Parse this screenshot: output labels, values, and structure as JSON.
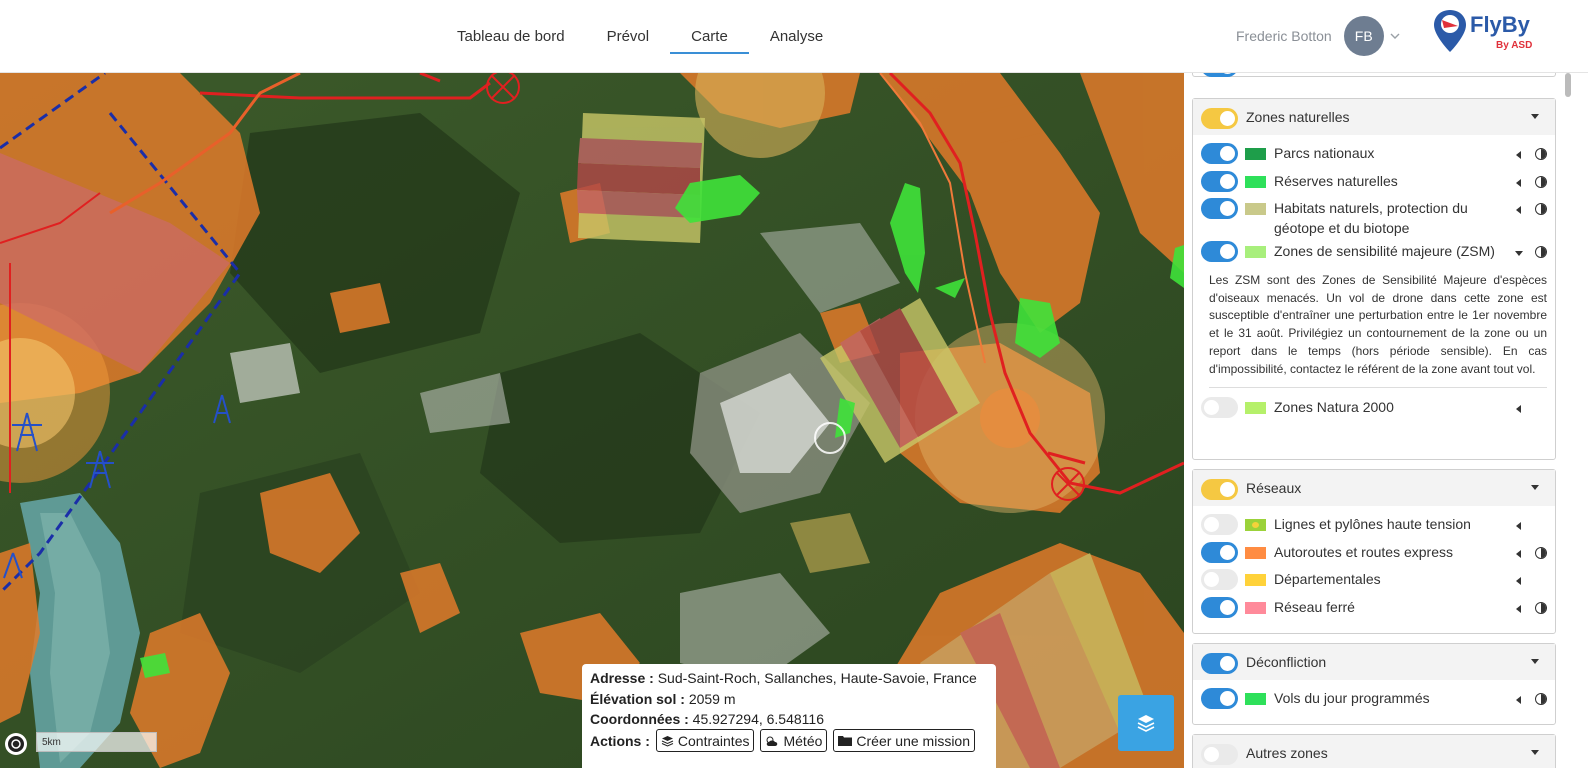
{
  "header": {
    "nav": [
      {
        "label": "Tableau de bord",
        "active": false
      },
      {
        "label": "Prévol",
        "active": false
      },
      {
        "label": "Carte",
        "active": true
      },
      {
        "label": "Analyse",
        "active": false
      }
    ],
    "user_name": "Frederic Botton",
    "avatar_initials": "FB",
    "logo_text": "FlyBy",
    "logo_sub": "By ASD",
    "accent": "#3a8fd6"
  },
  "map": {
    "scale_label": "5km",
    "popup": {
      "address_label": "Adresse :",
      "address": "Sud-Saint-Roch, Sallanches, Haute-Savoie, France",
      "elevation_label": "Élévation sol :",
      "elevation": "2059 m",
      "coords_label": "Coordonnées :",
      "coords": "45.927294, 6.548116",
      "actions_label": "Actions :",
      "btn_contraintes": "Contraintes",
      "btn_meteo": "Météo",
      "btn_mission": "Créer une mission"
    }
  },
  "sidebar": {
    "zones_naturelles": {
      "title": "Zones naturelles",
      "toggle": "on",
      "layers": [
        {
          "label": "Parcs nationaux",
          "color": "#1e9e4a",
          "toggle": "on"
        },
        {
          "label": "Réserves naturelles",
          "color": "#2ee05a",
          "toggle": "on"
        },
        {
          "label": "Habitats naturels, protection du géotope et du biotope",
          "color": "#c9c98a",
          "toggle": "on"
        },
        {
          "label": "Zones de sensibilité majeure (ZSM)",
          "color": "#a8ef7c",
          "toggle": "on"
        },
        {
          "label": "Zones Natura 2000",
          "color": "#b5f06a",
          "toggle": "off"
        }
      ],
      "zsm_description": "Les ZSM sont des Zones de Sensibilité Majeure d'espèces d'oiseaux menacés. Un vol de drone dans cette zone est susceptible d'entraîner une perturbation entre le 1er novembre et le 31 août. Privilégiez un contournement de la zone ou un report dans le temps (hors période sensible). En cas d'impossibilité, contactez le référent de la zone avant tout vol."
    },
    "reseaux": {
      "title": "Réseaux",
      "toggle": "on",
      "layers": [
        {
          "label": "Lignes et pylônes haute tension",
          "color": "#9bd23a",
          "toggle": "off"
        },
        {
          "label": "Autoroutes et routes express",
          "color": "#ff8c42",
          "toggle": "on"
        },
        {
          "label": "Départementales",
          "color": "#ffd23a",
          "toggle": "off"
        },
        {
          "label": "Réseau ferré",
          "color": "#ff8a9a",
          "toggle": "on"
        }
      ]
    },
    "deconfliction": {
      "title": "Déconfliction",
      "toggle": "on",
      "layers": [
        {
          "label": "Vols du jour programmés",
          "color": "#2ee05a",
          "toggle": "on"
        }
      ]
    },
    "autres_zones": {
      "title": "Autres zones",
      "toggle": "off"
    }
  }
}
